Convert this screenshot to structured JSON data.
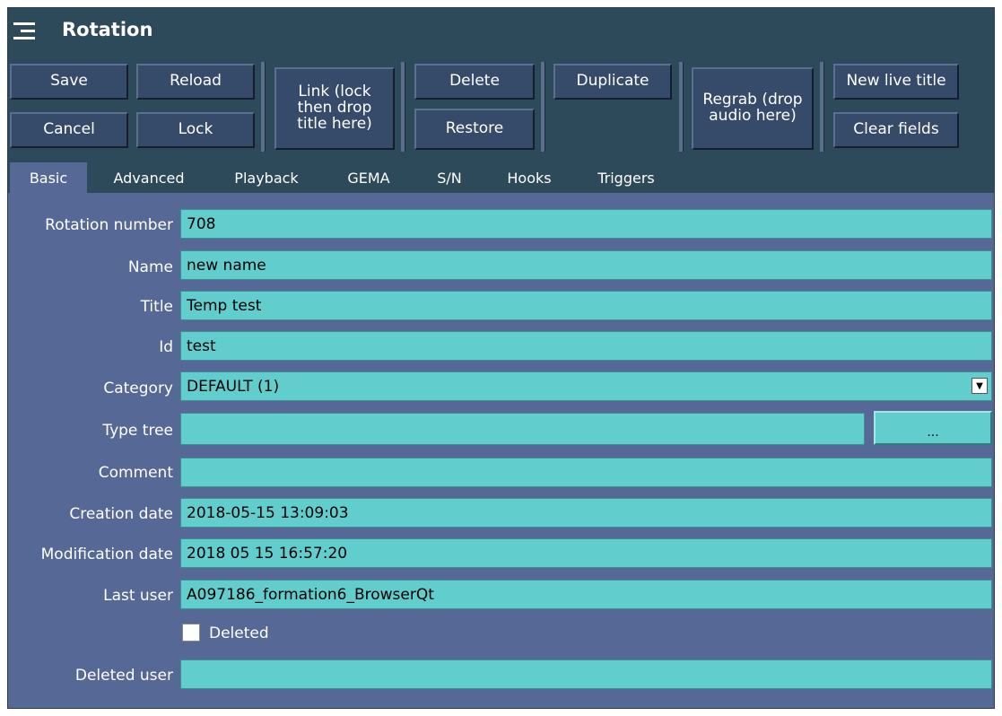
{
  "window": {
    "title": "Rotation",
    "menu_icon": "hamburger-icon"
  },
  "toolbar": {
    "save": "Save",
    "reload": "Reload",
    "cancel": "Cancel",
    "lock": "Lock",
    "link": "Link (lock\nthen drop\ntitle here)",
    "delete": "Delete",
    "restore": "Restore",
    "duplicate": "Duplicate",
    "regrab": "Regrab (drop\naudio here)",
    "new_live_title": "New live title",
    "clear_fields": "Clear fields"
  },
  "tabs": [
    {
      "label": "Basic",
      "active": true
    },
    {
      "label": "Advanced"
    },
    {
      "label": "Playback"
    },
    {
      "label": "GEMA"
    },
    {
      "label": "S/N"
    },
    {
      "label": "Hooks"
    },
    {
      "label": "Triggers"
    }
  ],
  "form": {
    "rotation_number": {
      "label": "Rotation number",
      "value": "708"
    },
    "name": {
      "label": "Name",
      "value": "new name"
    },
    "title": {
      "label": "Title",
      "value": "Temp test"
    },
    "id": {
      "label": "Id",
      "value": "test"
    },
    "category": {
      "label": "Category",
      "value": "DEFAULT (1)"
    },
    "type_tree": {
      "label": "Type tree",
      "value": "",
      "button": "..."
    },
    "comment": {
      "label": "Comment",
      "value": ""
    },
    "creation_date": {
      "label": "Creation date",
      "value": "2018-05-15 13:09:03"
    },
    "modification_date": {
      "label": "Modification date",
      "value": "2018 05 15 16:57:20"
    },
    "last_user": {
      "label": "Last user",
      "value": "A097186_formation6_BrowserQt"
    },
    "deleted": {
      "label": "Deleted",
      "checked": false
    },
    "deleted_user": {
      "label": "Deleted user",
      "value": ""
    }
  },
  "colors": {
    "window_bg": "#566896",
    "toolbar_bg": "#2c4a5a",
    "field_bg": "#62cdcd"
  }
}
